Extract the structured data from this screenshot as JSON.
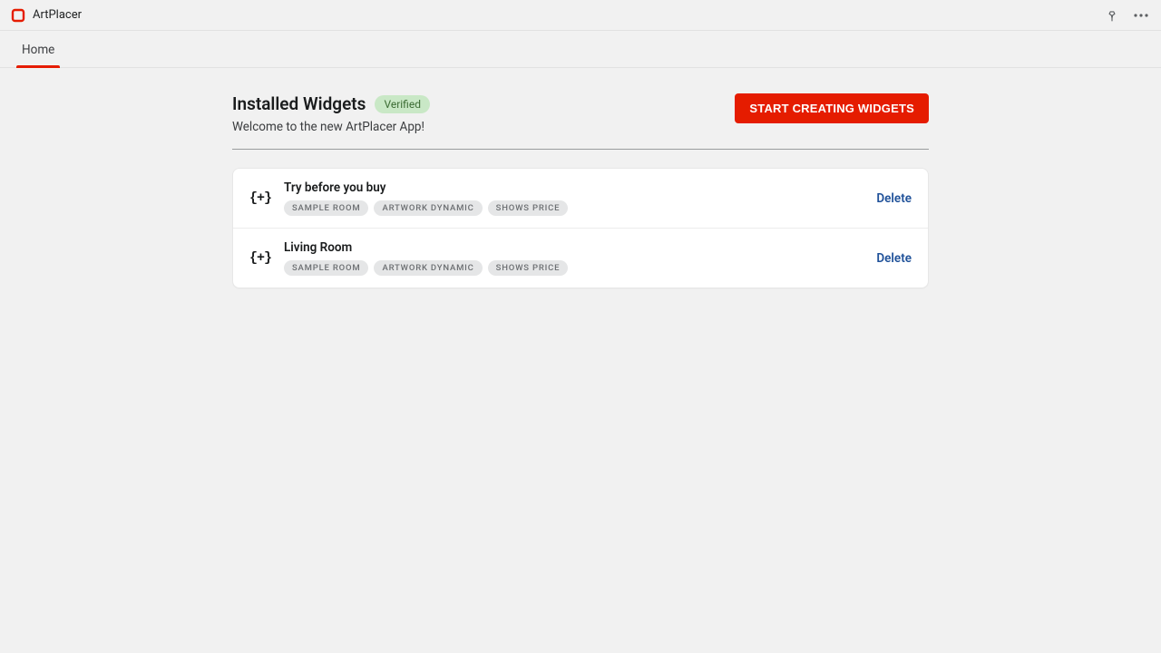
{
  "app": {
    "name": "ArtPlacer"
  },
  "tabs": [
    {
      "label": "Home"
    }
  ],
  "header": {
    "title": "Installed Widgets",
    "badge": "Verified",
    "subtitle": "Welcome to the new ArtPlacer App!",
    "cta": "START CREATING WIDGETS"
  },
  "widgets": [
    {
      "icon": "{+}",
      "title": "Try before you buy",
      "tags": [
        "SAMPLE ROOM",
        "ARTWORK DYNAMIC",
        "SHOWS PRICE"
      ],
      "action": "Delete"
    },
    {
      "icon": "{+}",
      "title": "Living Room",
      "tags": [
        "SAMPLE ROOM",
        "ARTWORK DYNAMIC",
        "SHOWS PRICE"
      ],
      "action": "Delete"
    }
  ]
}
